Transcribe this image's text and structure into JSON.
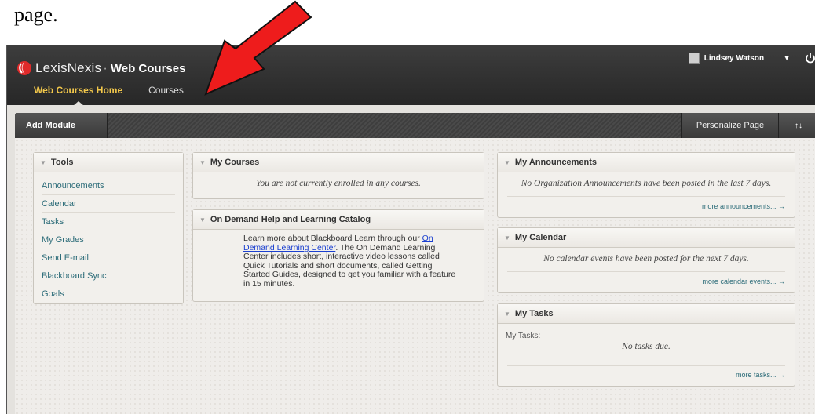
{
  "document": {
    "text": "page."
  },
  "header": {
    "brand_name": "LexisNexis",
    "brand_separator": "·",
    "product": "Web Courses",
    "nav": [
      {
        "label": "Web Courses Home",
        "active": true
      },
      {
        "label": "Courses",
        "active": false
      }
    ],
    "user_name": "Lindsey Watson",
    "user_caret": "▼",
    "power_icon": "power-icon"
  },
  "toolbar": {
    "add_module_label": "Add Module",
    "personalize_label": "Personalize Page",
    "sort_icon_glyph": "↑↓"
  },
  "modules": {
    "tools": {
      "title": "Tools",
      "items": [
        "Announcements",
        "Calendar",
        "Tasks",
        "My Grades",
        "Send E-mail",
        "Blackboard Sync",
        "Goals"
      ]
    },
    "my_courses": {
      "title": "My Courses",
      "message": "You are not currently enrolled in any courses."
    },
    "help": {
      "title": "On Demand Help and Learning Catalog",
      "text_before": "Learn more about Blackboard Learn through our ",
      "link_text": "On Demand Learning Center",
      "text_after": ". The On Demand Learning Center includes short, interactive video lessons called Quick Tutorials and short documents, called Getting Started Guides, designed to get you familiar with a feature in 15 minutes."
    },
    "announcements": {
      "title": "My Announcements",
      "message": "No Organization Announcements have been posted in the last 7 days.",
      "more": "more announcements... →"
    },
    "calendar": {
      "title": "My Calendar",
      "message": "No calendar events have been posted for the next 7 days.",
      "more": "more calendar events... →"
    },
    "tasks": {
      "title": "My Tasks",
      "label": "My Tasks:",
      "message": "No tasks due.",
      "more": "more tasks... →"
    }
  },
  "colors": {
    "header_bg": "#2f2f2f",
    "active_nav": "#f3c84b",
    "link": "#2b6b78",
    "arrow": "#ee1c1c"
  }
}
